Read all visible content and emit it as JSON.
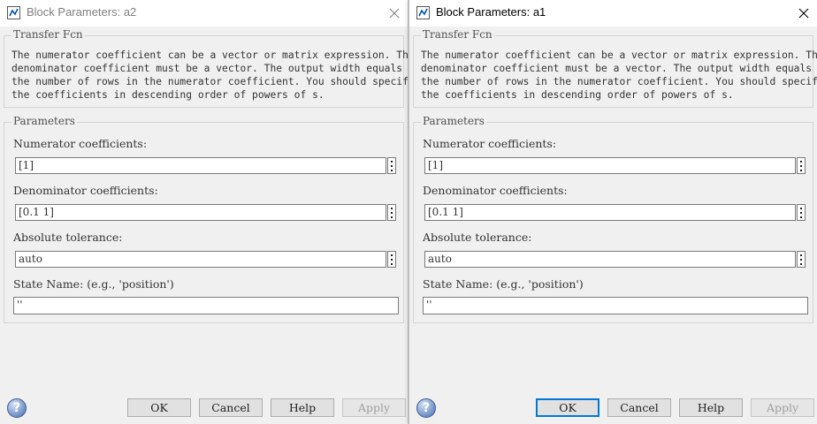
{
  "dialogs": [
    {
      "title": "Block Parameters: a2",
      "block_type": "Transfer Fcn",
      "description": "The numerator coefficient can be a vector or matrix expression. The\ndenominator coefficient must be a vector. The output width equals\nthe number of rows in the numerator coefficient. You should specify\nthe coefficients in descending order of powers of s.",
      "params_title": "Parameters",
      "numerator_label": "Numerator coefficients:",
      "numerator_value": "[1]",
      "denominator_label": "Denominator coefficients:",
      "denominator_value": "[0.1 1]",
      "tolerance_label": "Absolute tolerance:",
      "tolerance_value": "auto",
      "state_label": "State Name: (e.g., 'position')",
      "state_value": "''",
      "buttons": {
        "ok": "OK",
        "cancel": "Cancel",
        "help": "Help",
        "apply": "Apply"
      }
    },
    {
      "title": "Block Parameters: a1",
      "block_type": "Transfer Fcn",
      "description": "The numerator coefficient can be a vector or matrix expression. The\ndenominator coefficient must be a vector. The output width equals\nthe number of rows in the numerator coefficient. You should specify\nthe coefficients in descending order of powers of s.",
      "params_title": "Parameters",
      "numerator_label": "Numerator coefficients:",
      "numerator_value": "[1]",
      "denominator_label": "Denominator coefficients:",
      "denominator_value": "[0.1 1]",
      "tolerance_label": "Absolute tolerance:",
      "tolerance_value": "auto",
      "state_label": "State Name: (e.g., 'position')",
      "state_value": "''",
      "buttons": {
        "ok": "OK",
        "cancel": "Cancel",
        "help": "Help",
        "apply": "Apply"
      }
    }
  ],
  "icons": {
    "help": "help-icon",
    "close": "close-icon",
    "window": "simulink-block-icon",
    "more": "more-options-icon"
  },
  "colors": {
    "default_button_border": "#0078d7",
    "background": "#f0f0f0"
  }
}
